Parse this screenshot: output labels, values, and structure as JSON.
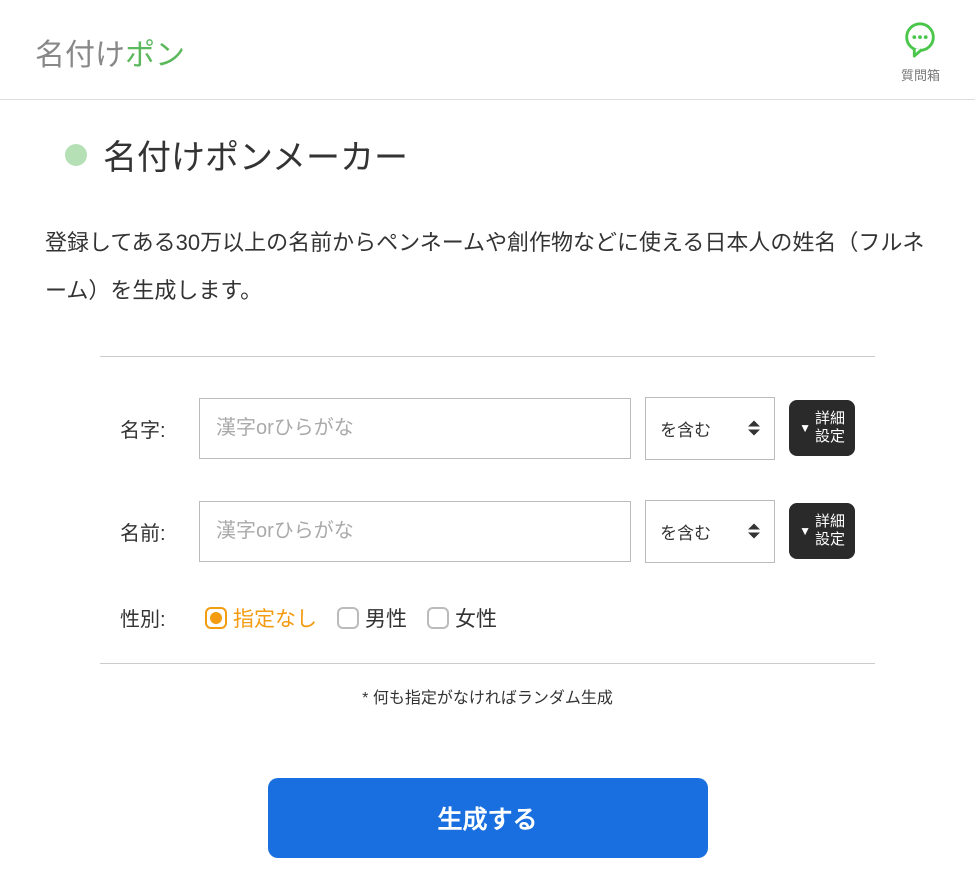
{
  "header": {
    "logo_gray": "名付け",
    "logo_green": "ポン",
    "question_box_label": "質問箱"
  },
  "page": {
    "title": "名付けポンメーカー",
    "description": "登録してある30万以上の名前からペンネームや創作物などに使える日本人の姓名（フルネーム）を生成します。"
  },
  "form": {
    "surname": {
      "label": "名字:",
      "placeholder": "漢字orひらがな",
      "select_value": "を含む",
      "detail_btn_l1": "詳細",
      "detail_btn_l2": "設定"
    },
    "firstname": {
      "label": "名前:",
      "placeholder": "漢字orひらがな",
      "select_value": "を含む",
      "detail_btn_l1": "詳細",
      "detail_btn_l2": "設定"
    },
    "gender": {
      "label": "性別:",
      "options": [
        {
          "label": "指定なし",
          "selected": true
        },
        {
          "label": "男性",
          "selected": false
        },
        {
          "label": "女性",
          "selected": false
        }
      ]
    },
    "note": "* 何も指定がなければランダム生成",
    "generate_button": "生成する"
  }
}
